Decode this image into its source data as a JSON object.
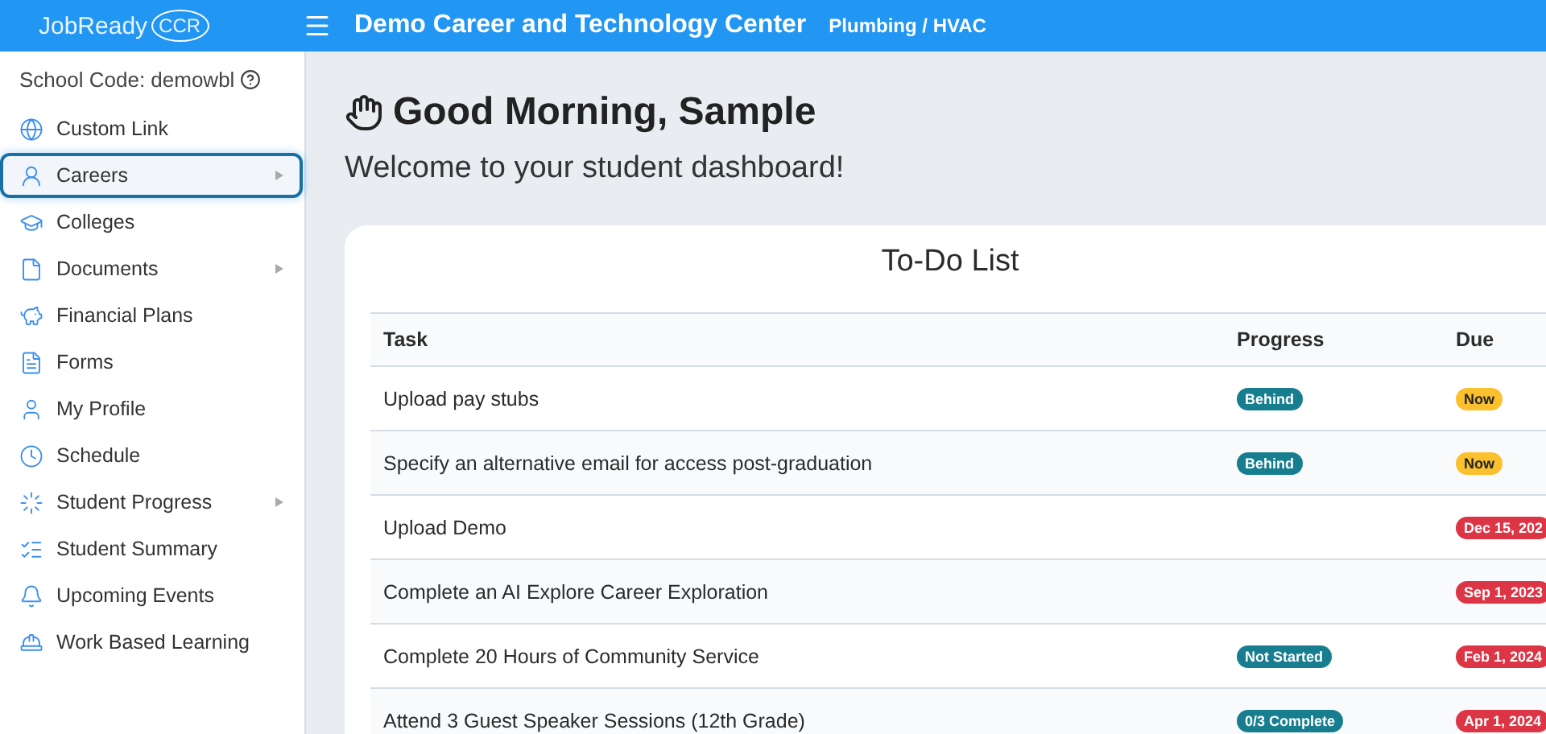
{
  "header": {
    "logo": "JobReady",
    "logo_badge": "CCR",
    "title": "Demo Career and Technology Center",
    "subtitle": "Plumbing / HVAC"
  },
  "sidebar": {
    "school_code": "School Code: demowbl",
    "items": [
      {
        "label": "Custom Link",
        "selected": false,
        "expandable": false
      },
      {
        "label": "Careers",
        "selected": true,
        "expandable": true
      },
      {
        "label": "Colleges",
        "selected": false,
        "expandable": false
      },
      {
        "label": "Documents",
        "selected": false,
        "expandable": true
      },
      {
        "label": "Financial Plans",
        "selected": false,
        "expandable": false
      },
      {
        "label": "Forms",
        "selected": false,
        "expandable": false
      },
      {
        "label": "My Profile",
        "selected": false,
        "expandable": false
      },
      {
        "label": "Schedule",
        "selected": false,
        "expandable": false
      },
      {
        "label": "Student Progress",
        "selected": false,
        "expandable": true
      },
      {
        "label": "Student Summary",
        "selected": false,
        "expandable": false
      },
      {
        "label": "Upcoming Events",
        "selected": false,
        "expandable": false
      },
      {
        "label": "Work Based Learning",
        "selected": false,
        "expandable": false
      }
    ]
  },
  "greeting": "Good Morning, Sample",
  "welcome": "Welcome to your student dashboard!",
  "todo": {
    "title": "To-Do List",
    "columns": [
      "Task",
      "Progress",
      "Due"
    ],
    "rows": [
      {
        "task": "Upload pay stubs",
        "progress": {
          "text": "Behind",
          "kind": "teal"
        },
        "due": {
          "text": "Now",
          "kind": "yellow"
        }
      },
      {
        "task": "Specify an alternative email for access post-graduation",
        "progress": {
          "text": "Behind",
          "kind": "teal"
        },
        "due": {
          "text": "Now",
          "kind": "yellow"
        }
      },
      {
        "task": "Upload Demo",
        "due": {
          "text": "Dec 15, 202",
          "kind": "red"
        }
      },
      {
        "task": "Complete an AI Explore Career Exploration",
        "due": {
          "text": "Sep 1, 2023",
          "kind": "red"
        }
      },
      {
        "task": "Complete 20 Hours of Community Service",
        "progress": {
          "text": "Not Started",
          "kind": "teal"
        },
        "due": {
          "text": "Feb 1, 2024",
          "kind": "red"
        }
      },
      {
        "task": "Attend 3 Guest Speaker Sessions (12th Grade)",
        "progress": {
          "text": "0/3 Complete",
          "kind": "teal"
        },
        "due": {
          "text": "Apr 1, 2024",
          "kind": "red"
        }
      }
    ]
  }
}
